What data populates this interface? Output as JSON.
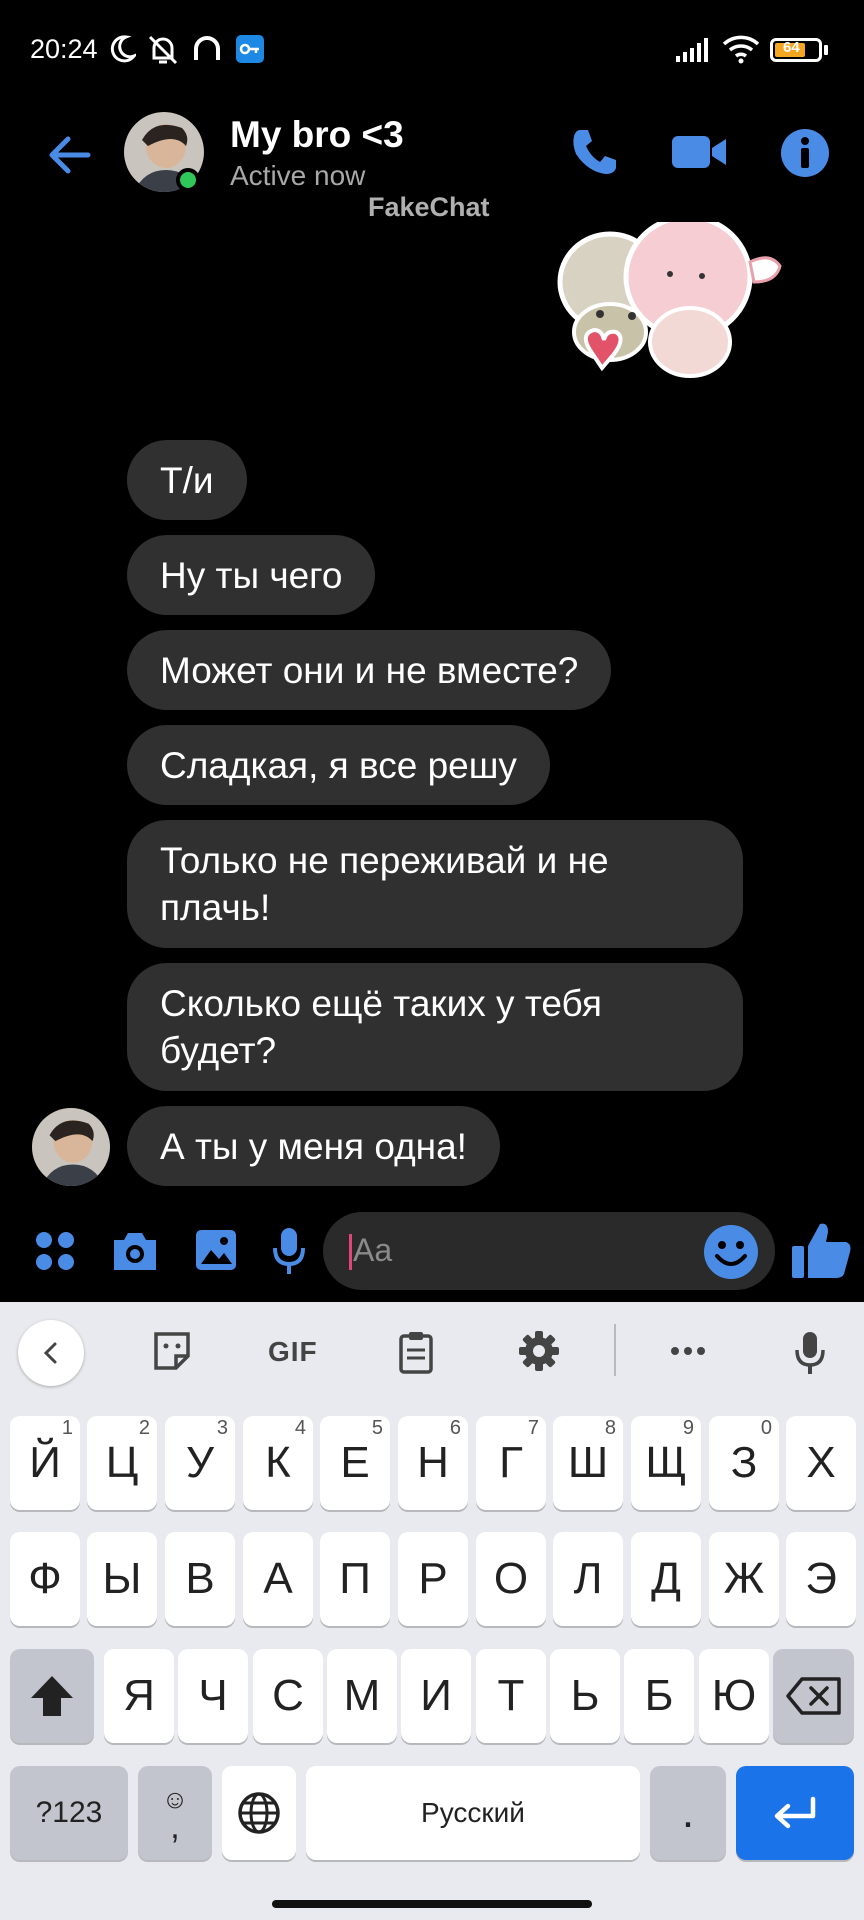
{
  "status_bar": {
    "time": "20:24",
    "battery": "64"
  },
  "header": {
    "contact_name": "My bro <3",
    "contact_status": "Active now",
    "watermark": "FakeChat"
  },
  "messages": [
    "Т/и",
    "Ну ты чего",
    "Может они и не вместе?",
    "Сладкая, я все решу",
    "Только не переживай и не плачь!",
    "Сколько ещё таких у тебя будет?",
    "А ты у меня одна!"
  ],
  "composer": {
    "placeholder": "Aa"
  },
  "keyboard": {
    "toolbar": {
      "gif": "GIF"
    },
    "row1": [
      {
        "k": "Й",
        "h": "1"
      },
      {
        "k": "Ц",
        "h": "2"
      },
      {
        "k": "У",
        "h": "3"
      },
      {
        "k": "К",
        "h": "4"
      },
      {
        "k": "Е",
        "h": "5"
      },
      {
        "k": "Н",
        "h": "6"
      },
      {
        "k": "Г",
        "h": "7"
      },
      {
        "k": "Ш",
        "h": "8"
      },
      {
        "k": "Щ",
        "h": "9"
      },
      {
        "k": "З",
        "h": "0"
      },
      {
        "k": "Х",
        "h": ""
      }
    ],
    "row2": [
      "Ф",
      "Ы",
      "В",
      "А",
      "П",
      "Р",
      "О",
      "Л",
      "Д",
      "Ж",
      "Э"
    ],
    "row3": [
      "Я",
      "Ч",
      "С",
      "М",
      "И",
      "Т",
      "Ь",
      "Б",
      "Ю"
    ],
    "symbols_key": "?123",
    "comma_key": ",",
    "space_label": "Русский",
    "period_key": "."
  },
  "colors": {
    "accent": "#4a8be6",
    "bubble": "#303030",
    "online": "#2fc75a",
    "enter_key": "#1a73e8"
  }
}
